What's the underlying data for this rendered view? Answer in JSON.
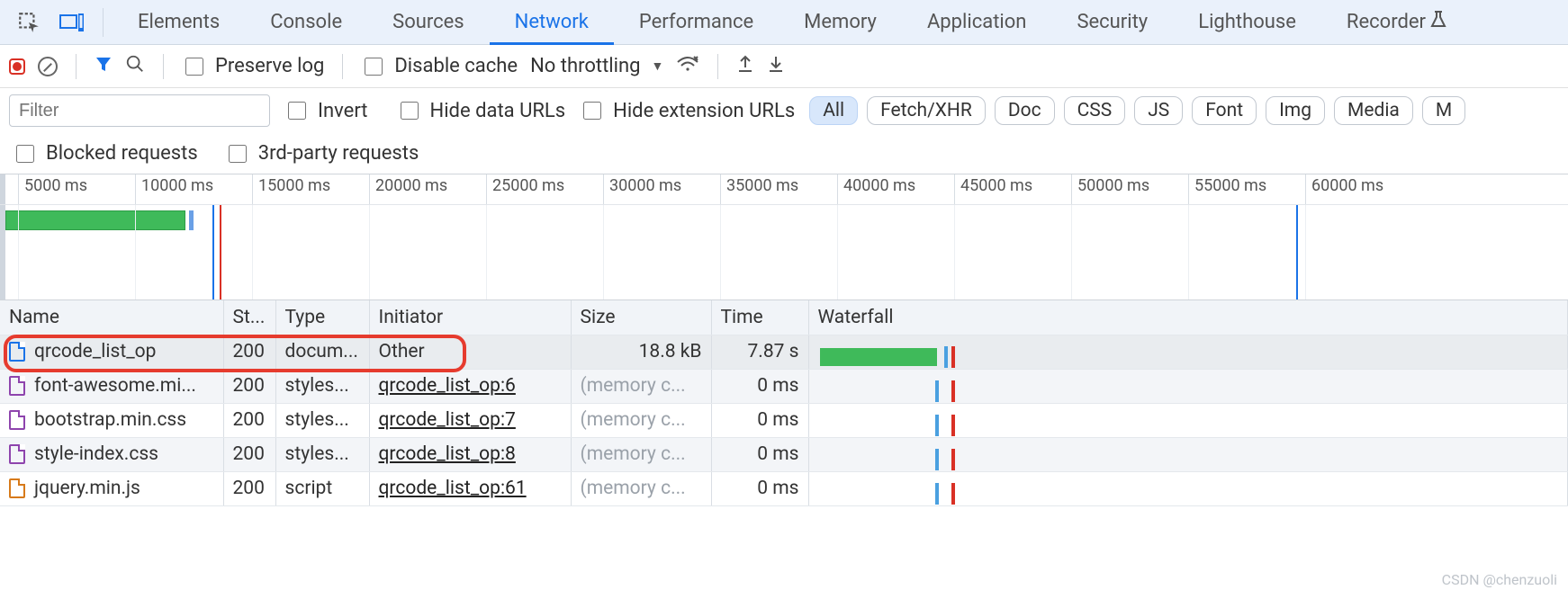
{
  "tabs": {
    "items": [
      "Elements",
      "Console",
      "Sources",
      "Network",
      "Performance",
      "Memory",
      "Application",
      "Security",
      "Lighthouse",
      "Recorder"
    ],
    "active": "Network"
  },
  "toolbar": {
    "preserve_log": "Preserve log",
    "disable_cache": "Disable cache",
    "throttling": "No throttling"
  },
  "filter": {
    "placeholder": "Filter",
    "invert": "Invert",
    "hide_data": "Hide data URLs",
    "hide_ext": "Hide extension URLs",
    "pills": [
      "All",
      "Fetch/XHR",
      "Doc",
      "CSS",
      "JS",
      "Font",
      "Img",
      "Media",
      "M"
    ],
    "active_pill": "All",
    "blocked": "Blocked requests",
    "third_party": "3rd-party requests"
  },
  "timeline": {
    "ticks": [
      "5000 ms",
      "10000 ms",
      "15000 ms",
      "20000 ms",
      "25000 ms",
      "30000 ms",
      "35000 ms",
      "40000 ms",
      "45000 ms",
      "50000 ms",
      "55000 ms",
      "60000 ms"
    ]
  },
  "columns": {
    "name": "Name",
    "status": "St...",
    "type": "Type",
    "initiator": "Initiator",
    "size": "Size",
    "time": "Time",
    "waterfall": "Waterfall"
  },
  "rows": [
    {
      "icon": "doc",
      "name": "qrcode_list_op",
      "status": "200",
      "type": "docum...",
      "initiator": "Other",
      "initiator_link": false,
      "size": "18.8 kB",
      "size_muted": false,
      "time": "7.87 s",
      "wf": "green",
      "sel": true
    },
    {
      "icon": "css",
      "name": "font-awesome.mi...",
      "status": "200",
      "type": "styles...",
      "initiator": "qrcode_list_op:6",
      "initiator_link": true,
      "size": "(memory c...",
      "size_muted": true,
      "time": "0 ms",
      "wf": "tick",
      "sel": false
    },
    {
      "icon": "css",
      "name": "bootstrap.min.css",
      "status": "200",
      "type": "styles...",
      "initiator": "qrcode_list_op:7",
      "initiator_link": true,
      "size": "(memory c...",
      "size_muted": true,
      "time": "0 ms",
      "wf": "tick",
      "sel": false
    },
    {
      "icon": "css",
      "name": "style-index.css",
      "status": "200",
      "type": "styles...",
      "initiator": "qrcode_list_op:8",
      "initiator_link": true,
      "size": "(memory c...",
      "size_muted": true,
      "time": "0 ms",
      "wf": "tick",
      "sel": false
    },
    {
      "icon": "js",
      "name": "jquery.min.js",
      "status": "200",
      "type": "script",
      "initiator": "qrcode_list_op:61",
      "initiator_link": true,
      "size": "(memory c...",
      "size_muted": true,
      "time": "0 ms",
      "wf": "tick",
      "sel": false
    }
  ],
  "watermark": "CSDN @chenzuoli"
}
